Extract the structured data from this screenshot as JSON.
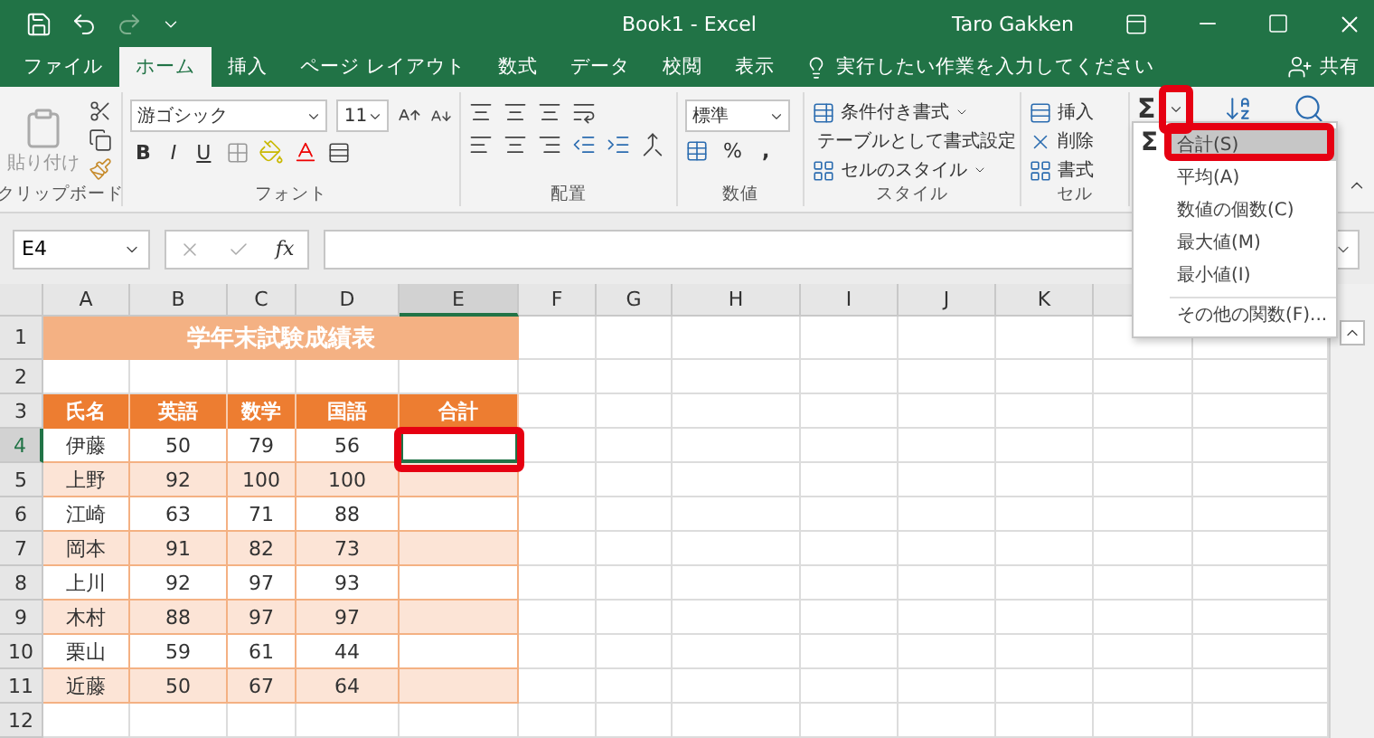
{
  "title_bar": {
    "title": "Book1 - Excel",
    "user": "Taro Gakken"
  },
  "tabs": [
    {
      "label": "ファイル",
      "selected": false
    },
    {
      "label": "ホーム",
      "selected": true
    },
    {
      "label": "挿入",
      "selected": false
    },
    {
      "label": "ページ レイアウト",
      "selected": false
    },
    {
      "label": "数式",
      "selected": false
    },
    {
      "label": "データ",
      "selected": false
    },
    {
      "label": "校閲",
      "selected": false
    },
    {
      "label": "表示",
      "selected": false
    }
  ],
  "tell_me": "実行したい作業を入力してください",
  "share": "共有",
  "ribbon": {
    "clipboard": {
      "paste": "貼り付け",
      "label": "クリップボード"
    },
    "font": {
      "name": "游ゴシック",
      "size": "11",
      "bold": "B",
      "italic": "I",
      "underline": "U",
      "label": "フォント"
    },
    "alignment": {
      "label": "配置"
    },
    "number": {
      "format": "標準",
      "percent": "%",
      "comma": ",",
      "label": "数値"
    },
    "styles": {
      "items": [
        "条件付き書式",
        "テーブルとして書式設定",
        "セルのスタイル"
      ],
      "label": "スタイル"
    },
    "cells": {
      "items": [
        "挿入",
        "削除",
        "書式"
      ],
      "label": "セル"
    },
    "editing": {
      "sum": "Σ"
    }
  },
  "formula_bar": {
    "name_box": "E4",
    "fx": "fx"
  },
  "columns": [
    {
      "label": "A",
      "selected": false
    },
    {
      "label": "B",
      "selected": false
    },
    {
      "label": "C",
      "selected": false
    },
    {
      "label": "D",
      "selected": false
    },
    {
      "label": "E",
      "selected": true
    },
    {
      "label": "F",
      "selected": false
    },
    {
      "label": "G",
      "selected": false
    },
    {
      "label": "H",
      "selected": false
    },
    {
      "label": "I",
      "selected": false
    },
    {
      "label": "J",
      "selected": false
    },
    {
      "label": "K",
      "selected": false
    }
  ],
  "rows": [
    {
      "num": "1",
      "selected": false,
      "kind": "title",
      "cells": [
        "学年末試験成績表"
      ]
    },
    {
      "num": "2",
      "selected": false,
      "kind": "blank"
    },
    {
      "num": "3",
      "selected": false,
      "kind": "header",
      "cells": [
        "氏名",
        "英語",
        "数学",
        "国語",
        "合計"
      ]
    },
    {
      "num": "4",
      "selected": true,
      "kind": "data",
      "banded": false,
      "cells": [
        "伊藤",
        "50",
        "79",
        "56"
      ]
    },
    {
      "num": "5",
      "selected": false,
      "kind": "data",
      "banded": true,
      "cells": [
        "上野",
        "92",
        "100",
        "100"
      ]
    },
    {
      "num": "6",
      "selected": false,
      "kind": "data",
      "banded": false,
      "cells": [
        "江崎",
        "63",
        "71",
        "88"
      ]
    },
    {
      "num": "7",
      "selected": false,
      "kind": "data",
      "banded": true,
      "cells": [
        "岡本",
        "91",
        "82",
        "73"
      ]
    },
    {
      "num": "8",
      "selected": false,
      "kind": "data",
      "banded": false,
      "cells": [
        "上川",
        "92",
        "97",
        "93"
      ]
    },
    {
      "num": "9",
      "selected": false,
      "kind": "data",
      "banded": true,
      "cells": [
        "木村",
        "88",
        "97",
        "97"
      ]
    },
    {
      "num": "10",
      "selected": false,
      "kind": "data",
      "banded": false,
      "cells": [
        "栗山",
        "59",
        "61",
        "44"
      ]
    },
    {
      "num": "11",
      "selected": false,
      "kind": "data",
      "banded": true,
      "cells": [
        "近藤",
        "50",
        "67",
        "64"
      ]
    },
    {
      "num": "12",
      "selected": false,
      "kind": "blank"
    }
  ],
  "sum_menu": {
    "icon": "Σ",
    "items": [
      {
        "label": "合計(S)",
        "selected": true
      },
      {
        "label": "平均(A)",
        "selected": false
      },
      {
        "label": "数値の個数(C)",
        "selected": false
      },
      {
        "label": "最大値(M)",
        "selected": false
      },
      {
        "label": "最小値(I)",
        "selected": false
      },
      {
        "label": "その他の関数(F)...",
        "selected": false,
        "separated": true
      }
    ]
  }
}
